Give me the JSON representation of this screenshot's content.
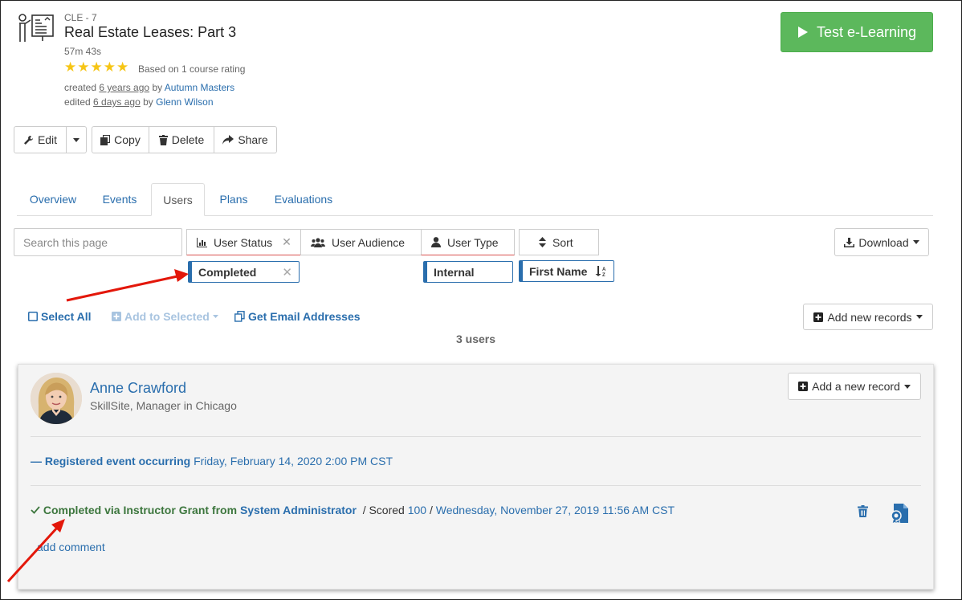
{
  "course": {
    "code": "CLE - 7",
    "title": "Real Estate Leases: Part 3",
    "duration": "57m 43s",
    "rating_stars": 5,
    "rating_text": "Based on 1 course rating",
    "created_prefix": "created",
    "created_when": "6 years ago",
    "created_by_word": "by",
    "created_by": "Autumn Masters",
    "edited_prefix": "edited",
    "edited_when": "6 days ago",
    "edited_by_word": "by",
    "edited_by": "Glenn Wilson"
  },
  "actions": {
    "test_label": "Test e-Learning",
    "edit": "Edit",
    "copy": "Copy",
    "delete": "Delete",
    "share": "Share"
  },
  "tabs": [
    "Overview",
    "Events",
    "Users",
    "Plans",
    "Evaluations"
  ],
  "active_tab": "Users",
  "filters": {
    "search_placeholder": "Search this page",
    "user_status": "User Status",
    "user_audience": "User Audience",
    "user_type": "User Type",
    "sort": "Sort",
    "download": "Download",
    "chip_status": "Completed",
    "chip_type": "Internal",
    "chip_sort": "First Name"
  },
  "toolbar": {
    "select_all": "Select All",
    "add_to_selected": "Add to Selected",
    "get_emails": "Get Email Addresses",
    "add_new_records": "Add new records",
    "count": "3 users"
  },
  "user": {
    "name": "Anne Crawford",
    "subtitle": "SkillSite, Manager in Chicago",
    "add_record": "Add a new record",
    "registered_label": "Registered event occurring",
    "registered_date": "Friday, February 14, 2020 2:00 PM CST",
    "completed_label": "Completed via Instructor Grant from",
    "completed_by": "System Administrator",
    "scored_label": "/ Scored",
    "score": "100",
    "sep": "/",
    "completed_date": "Wednesday, November 27, 2019 11:56 AM CST",
    "add_comment": "add comment"
  },
  "colors": {
    "accent": "#2a6ead",
    "success": "#5cb85c",
    "completed_text": "#3c763d",
    "star": "#f6c515",
    "annotation_arrow": "#e3170a"
  }
}
